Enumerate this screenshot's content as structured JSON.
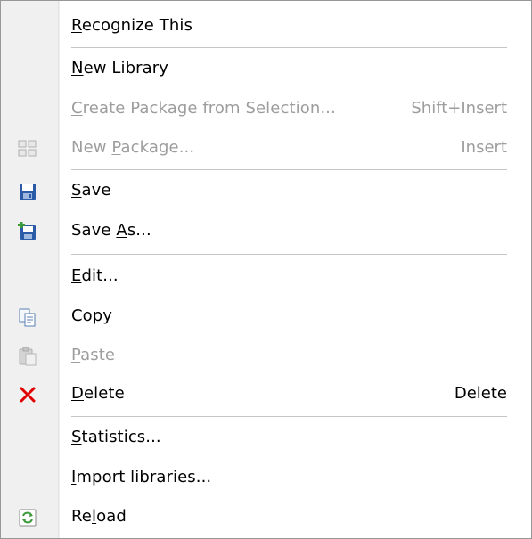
{
  "menu": {
    "items": [
      {
        "id": "recognize-this",
        "pre": "",
        "acc": "R",
        "post": "ecognize This",
        "shortcut": "",
        "disabled": false,
        "icon": ""
      },
      {
        "id": "new-library",
        "pre": "",
        "acc": "N",
        "post": "ew Library",
        "shortcut": "",
        "disabled": false,
        "icon": ""
      },
      {
        "id": "create-package-from-selection",
        "pre": "",
        "acc": "C",
        "post": "reate Package from Selection...",
        "shortcut": "Shift+Insert",
        "disabled": true,
        "icon": ""
      },
      {
        "id": "new-package",
        "pre": "New ",
        "acc": "P",
        "post": "ackage...",
        "shortcut": "Insert",
        "disabled": true,
        "icon": "package-grid-icon"
      },
      {
        "id": "save",
        "pre": "",
        "acc": "S",
        "post": "ave",
        "shortcut": "",
        "disabled": false,
        "icon": "floppy-disk-icon"
      },
      {
        "id": "save-as",
        "pre": "Save ",
        "acc": "A",
        "post": "s...",
        "shortcut": "",
        "disabled": false,
        "icon": "save-as-icon"
      },
      {
        "id": "edit",
        "pre": "",
        "acc": "E",
        "post": "dit...",
        "shortcut": "",
        "disabled": false,
        "icon": ""
      },
      {
        "id": "copy",
        "pre": "",
        "acc": "C",
        "post": "opy",
        "shortcut": "",
        "disabled": false,
        "icon": "copy-icon"
      },
      {
        "id": "paste",
        "pre": "",
        "acc": "P",
        "post": "aste",
        "shortcut": "",
        "disabled": true,
        "icon": "paste-icon"
      },
      {
        "id": "delete",
        "pre": "",
        "acc": "D",
        "post": "elete",
        "shortcut": "Delete",
        "disabled": false,
        "icon": "red-x-icon"
      },
      {
        "id": "statistics",
        "pre": "",
        "acc": "S",
        "post": "tatistics...",
        "shortcut": "",
        "disabled": false,
        "icon": ""
      },
      {
        "id": "import-libraries",
        "pre": "",
        "acc": "I",
        "post": "mport libraries...",
        "shortcut": "",
        "disabled": false,
        "icon": ""
      },
      {
        "id": "reload",
        "pre": "Re",
        "acc": "l",
        "post": "oad",
        "shortcut": "",
        "disabled": false,
        "icon": "reload-icon"
      }
    ]
  },
  "colors": {
    "text": "#000000",
    "disabled_text": "#9d9d9d",
    "delete_icon": "#e00000",
    "save_icon": "#2a5aa8",
    "reload_icon": "#3a9a3a"
  }
}
